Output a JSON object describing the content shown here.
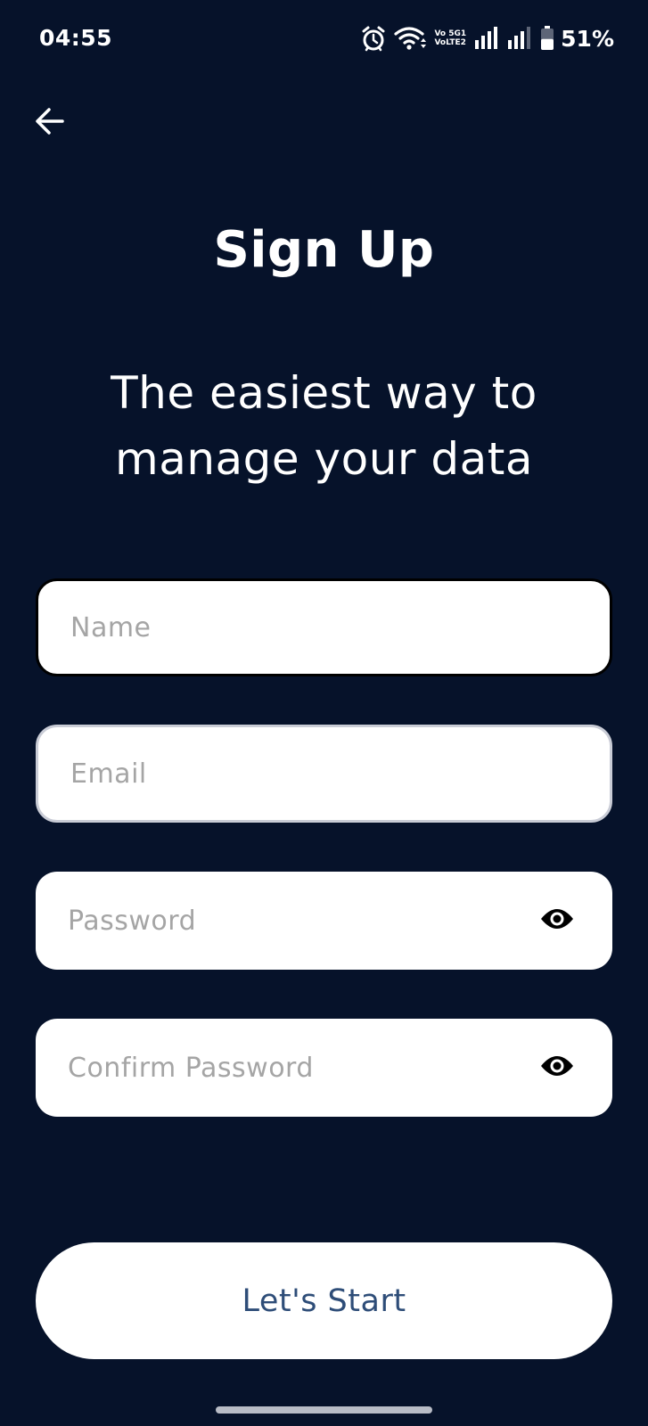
{
  "status_bar": {
    "time": "04:55",
    "volte_top": "Vo 5G1",
    "volte_bottom": "VoLTE2",
    "battery_percent": "51%",
    "battery_level": 0.51,
    "icons": [
      "alarm-icon",
      "wifi-icon",
      "volte-5g-icon",
      "signal-icon",
      "signal-icon",
      "battery-icon"
    ]
  },
  "header": {
    "back_icon": "arrow-left-icon",
    "title": "Sign Up",
    "subtitle_line1": "The easiest way to",
    "subtitle_line2": "manage your data"
  },
  "form": {
    "name_placeholder": "Name",
    "email_placeholder": "Email",
    "password_placeholder": "Password",
    "confirm_placeholder": "Confirm Password",
    "password_toggle_icon": "eye-icon",
    "confirm_toggle_icon": "eye-icon"
  },
  "actions": {
    "start_label": "Let's Start"
  },
  "colors": {
    "background": "#06122a",
    "field_background": "#ffffff",
    "button_text": "#2e4d78",
    "placeholder": "#a5a5a5"
  }
}
